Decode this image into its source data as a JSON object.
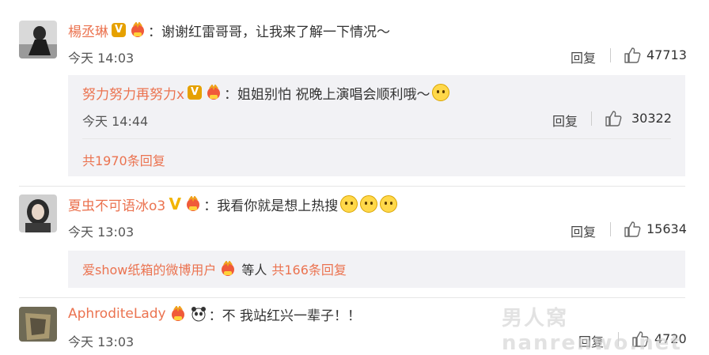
{
  "comments": [
    {
      "user": "楊丞琳",
      "badge": "V",
      "text": "：谢谢红雷哥哥，让我来了解一下情况～",
      "time": "今天 14:03",
      "reply_label": "回复",
      "likes": "47713",
      "sub_reply": {
        "user": "努力努力再努力x",
        "badge": "V",
        "text": "：姐姐别怕 祝晚上演唱会顺利哦～",
        "time": "今天 14:44",
        "reply_label": "回复",
        "likes": "30322"
      },
      "more_replies": "共1970条回复"
    },
    {
      "user": "夏虫不可语冰o3",
      "badge": "V",
      "text": "：我看你就是想上热搜",
      "time": "今天 13:03",
      "reply_label": "回复",
      "likes": "15634",
      "sub_summary": {
        "user": "爱show纸箱的微博用户",
        "middle": "等人",
        "count": "共166条回复"
      }
    },
    {
      "user": "AphroditeLady",
      "text": "：不  我站红兴一辈子！！",
      "time": "今天 13:03",
      "reply_label": "回复",
      "likes": "4720"
    }
  ],
  "watermark": "男人窝 nanrenwo.net",
  "colors": {
    "username": "#eb7350",
    "sub_bg": "#f2f2f5",
    "vip_gold": "#e6a100"
  },
  "icons": [
    "thumbs-up-icon",
    "fan-badge-icon",
    "verified-badge-icon",
    "emoji-icon",
    "panda-icon"
  ]
}
